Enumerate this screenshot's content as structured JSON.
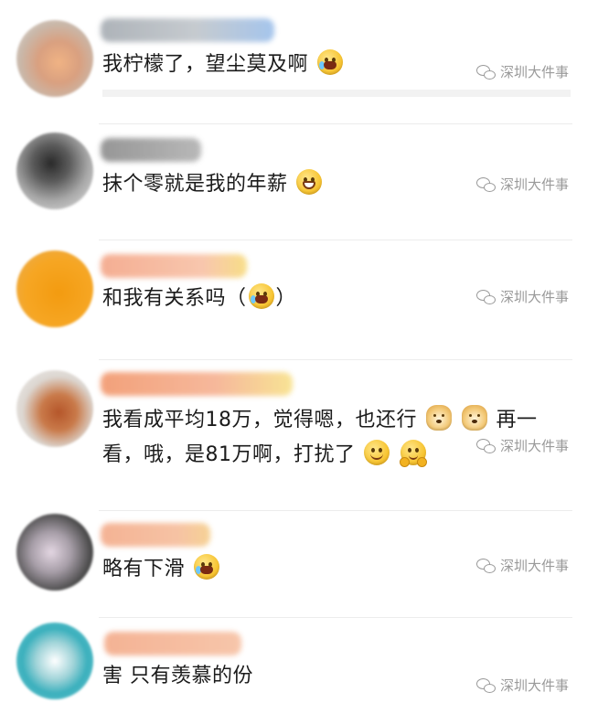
{
  "comments": [
    {
      "text": "我柠檬了，望尘莫及啊",
      "emojis": [
        "laugh-cry-emoji"
      ],
      "watermark": "深圳大件事"
    },
    {
      "text": "抹个零就是我的年薪",
      "emojis": [
        "grin-emoji"
      ],
      "watermark": "深圳大件事"
    },
    {
      "text": "和我有关系吗（",
      "text_after": "）",
      "emojis": [
        "crying-emoji"
      ],
      "watermark": "深圳大件事"
    },
    {
      "text_line1": "我看成平均18万，觉得嗯，也还行",
      "text_line1_after": "再一",
      "text_line2": "看，哦，是81万啊，打扰了",
      "emojis": [
        "doge-emoji",
        "doge-emoji",
        "smile-emoji",
        "hug-emoji"
      ],
      "watermark": "深圳大件事"
    },
    {
      "text": "略有下滑",
      "emojis": [
        "laugh-cry-emoji"
      ],
      "watermark": "深圳大件事"
    },
    {
      "text": "害 只有羡慕的份",
      "emojis": [],
      "watermark": "深圳大件事"
    }
  ],
  "colors": {
    "text": "#1b1b1b",
    "watermark": "#9a9a9a",
    "divider": "#ececec"
  }
}
